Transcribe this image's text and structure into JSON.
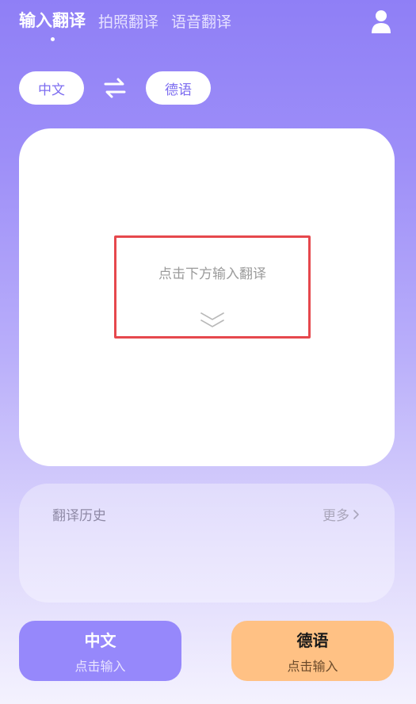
{
  "tabs": [
    {
      "label": "输入翻译",
      "active": true
    },
    {
      "label": "拍照翻译",
      "active": false
    },
    {
      "label": "语音翻译",
      "active": false
    }
  ],
  "header": {
    "user_icon": "user-icon"
  },
  "languages": {
    "source": "中文",
    "target": "德语",
    "swap_icon": "swap-arrows-icon"
  },
  "input_card": {
    "hint": "点击下方输入翻译",
    "chevron_icon": "double-chevron-down-icon"
  },
  "history": {
    "title": "翻译历史",
    "more": "更多"
  },
  "bottom_buttons": [
    {
      "title": "中文",
      "subtitle": "点击输入"
    },
    {
      "title": "德语",
      "subtitle": "点击输入"
    }
  ],
  "colors": {
    "accent": "#7c6cf0",
    "source_button": "#9688fb",
    "target_button": "#ffc184",
    "highlight_border": "#e6484d"
  }
}
